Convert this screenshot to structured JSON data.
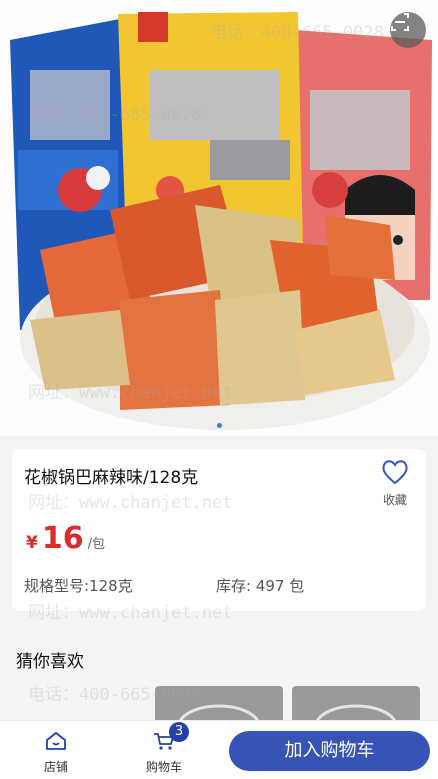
{
  "product": {
    "title": "花椒锅巴麻辣味/128克",
    "currency": "¥",
    "price": "16",
    "unit": "/包",
    "spec": "规格型号:128克",
    "stock": "库存: 497 包",
    "favorite_label": "收藏"
  },
  "recommend": {
    "title": "猜你喜欢"
  },
  "bottom_bar": {
    "store_label": "店铺",
    "cart_label": "购物车",
    "cart_count": "3",
    "add_to_cart": "加入购物车"
  },
  "watermark": {
    "phone": "电话：400-665-0028",
    "site": "网址：www.chanjet.net"
  },
  "carousel": {
    "slides": 1,
    "active": 1
  },
  "icons": {
    "scan": "scan-icon",
    "favorite": "heart-icon",
    "store": "home-icon",
    "cart": "cart-icon"
  },
  "colors": {
    "accent": "#3554b5",
    "price": "#e02a2a",
    "badge": "#2440a8"
  }
}
